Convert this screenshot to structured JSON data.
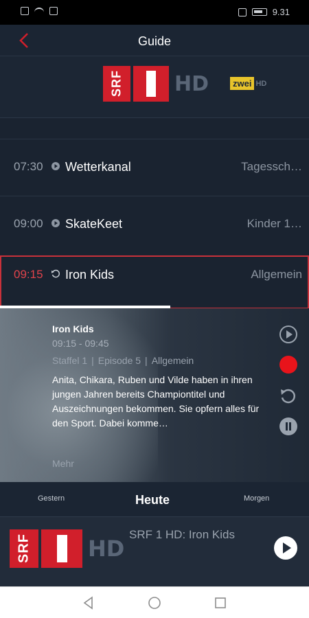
{
  "status_bar": {
    "time": "9.31"
  },
  "header": {
    "title": "Guide"
  },
  "channels": [
    {
      "name": "SRF 1 HD",
      "logo_text": "SRF",
      "hd": "HD"
    },
    {
      "name": "SRF zwei HD",
      "logo_text": "zwei",
      "hd": "HD"
    }
  ],
  "schedule": [
    {
      "time": "07:30",
      "title": "Wetterkanal",
      "genre": "Tagessch…",
      "icon": "play-circle-icon"
    },
    {
      "time": "09:00",
      "title": "SkateKeet",
      "genre": "Kinder 1…",
      "icon": "play-circle-icon"
    },
    {
      "time": "09:15",
      "title": "Iron Kids",
      "genre": "Allgemein",
      "icon": "replay-icon"
    }
  ],
  "detail": {
    "title": "Iron Kids",
    "time_range": "09:15 - 09:45",
    "season": "Staffel 1",
    "episode": "Episode 5",
    "genre": "Allgemein",
    "separator": "|",
    "description": "Anita, Chikara, Ruben und Vilde haben in ihren jungen Jahren bereits Championtitel und Auszeichnungen bekommen. Sie opfern alles für den Sport. Dabei komme…",
    "more_label": "Mehr",
    "progress_fraction": 0.55
  },
  "days": {
    "prev": "Gestern",
    "current": "Heute",
    "next": "Morgen"
  },
  "now_playing": {
    "title": "SRF 1 HD: Iron Kids"
  },
  "colors": {
    "accent_red": "#d11f2b",
    "record_red": "#e8141b",
    "background": "#1a2330"
  }
}
